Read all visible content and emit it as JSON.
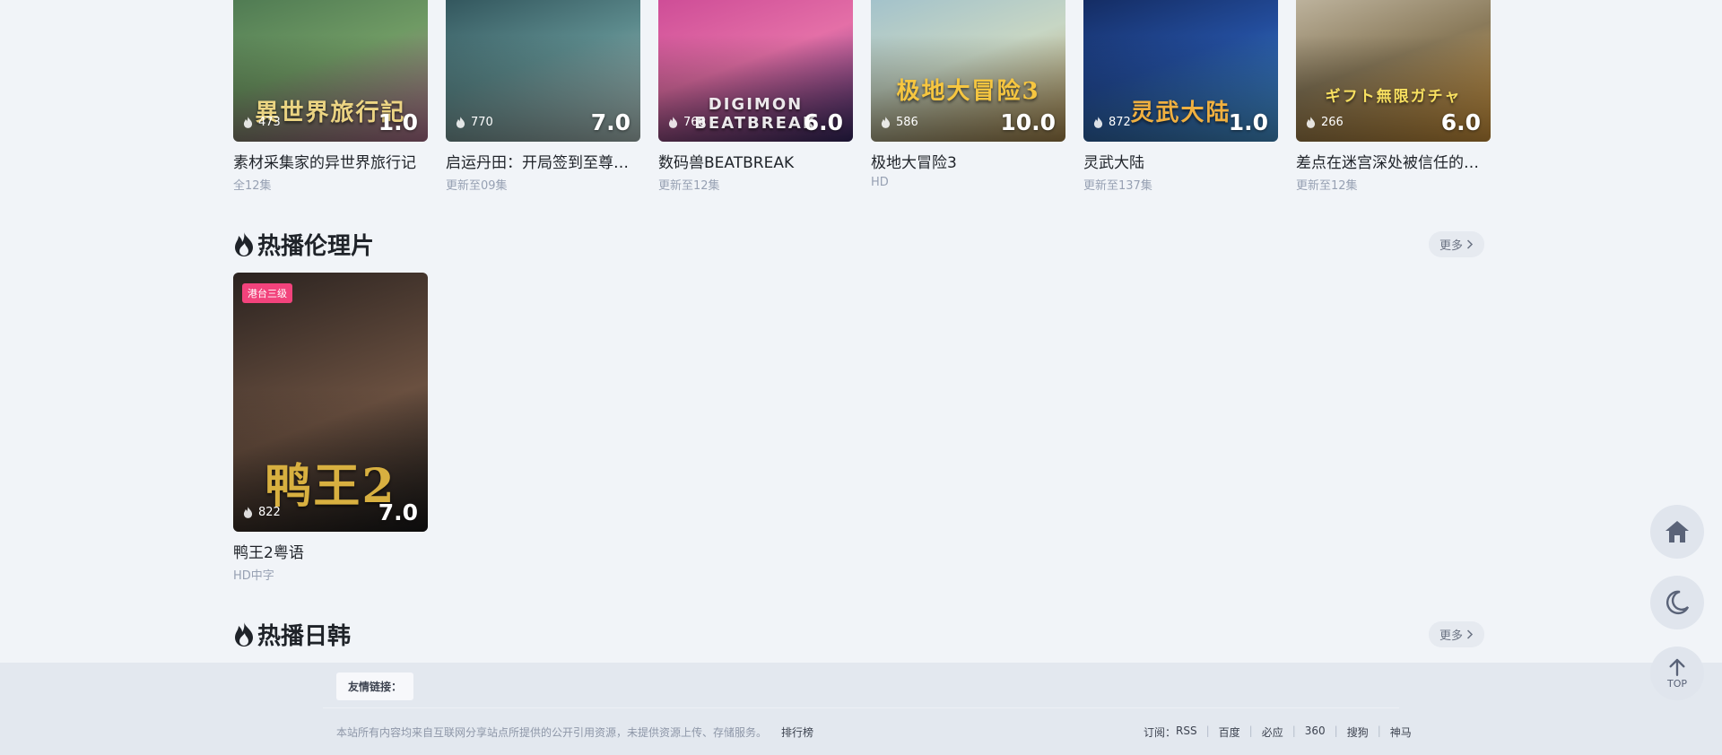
{
  "colors": {
    "background": "#f1f4f8",
    "footer_bg": "#e3e8ef",
    "tag_pink": "#f2437c",
    "muted_text": "#97a1b3",
    "icon_slate": "#5a6378"
  },
  "icons": {
    "heat": "flame-icon",
    "section": "fire-icon",
    "more": "chevron-right-icon",
    "home": "home-icon",
    "theme": "moon-icon",
    "top": "arrow-up-icon"
  },
  "top_row": [
    {
      "title": "素材采集家的异世界旅行记",
      "sub": "全12集",
      "heat": "473",
      "score": "1.0",
      "art": "異世界旅行記",
      "colors": [
        "#3f6a4a",
        "#6f9a64",
        "#c07a9a"
      ]
    },
    {
      "title": "启运丹田：开局签到至尊…",
      "sub": "更新至09集",
      "heat": "770",
      "score": "7.0",
      "art": "",
      "colors": [
        "#1c3a44",
        "#5c8a8c",
        "#bcd0cc"
      ]
    },
    {
      "title": "数码兽BEATBREAK",
      "sub": "更新至12集",
      "heat": "766",
      "score": "6.0",
      "art": "DIGIMON BEATBREAK",
      "colors": [
        "#c23a8e",
        "#e46fa7",
        "#3a2a6a"
      ]
    },
    {
      "title": "极地大冒险3",
      "sub": "HD",
      "heat": "586",
      "score": "10.0",
      "art": "极地大冒险3",
      "colors": [
        "#8fb7cf",
        "#c7d6c4",
        "#b49050"
      ]
    },
    {
      "title": "灵武大陆",
      "sub": "更新至137集",
      "heat": "872",
      "score": "1.0",
      "art": "灵武大陆",
      "colors": [
        "#0c1a44",
        "#234d9c",
        "#4aa0e0"
      ]
    },
    {
      "title": "差点在迷宫深处被信任的…",
      "sub": "更新至12集",
      "heat": "266",
      "score": "6.0",
      "art": "ギフト無限ガチャ",
      "colors": [
        "#d9d2c2",
        "#8a7a5a",
        "#e0a040"
      ]
    }
  ],
  "sections": [
    {
      "title": "热播伦理片",
      "more": "更多",
      "items": [
        {
          "title": "鸭王2粤语",
          "sub": "HD中字",
          "heat": "822",
          "score": "7.0",
          "tag": "港台三级",
          "art": "鸭王2",
          "colors": [
            "#2b2320",
            "#6a5040",
            "#1a1a1a"
          ]
        }
      ]
    },
    {
      "title": "热播日韩",
      "more": "更多",
      "items": []
    }
  ],
  "footer": {
    "friend_links_label": "友情链接：",
    "copyright": "本站所有内容均来自互联网分享站点所提供的公开引用资源，未提供资源上传、存储服务。",
    "rank_link": "排行榜",
    "subscribe_label": "订阅：",
    "subscribe_links": [
      "RSS",
      "百度",
      "必应",
      "360",
      "搜狗",
      "神马"
    ]
  },
  "floating": {
    "top_label": "TOP"
  }
}
